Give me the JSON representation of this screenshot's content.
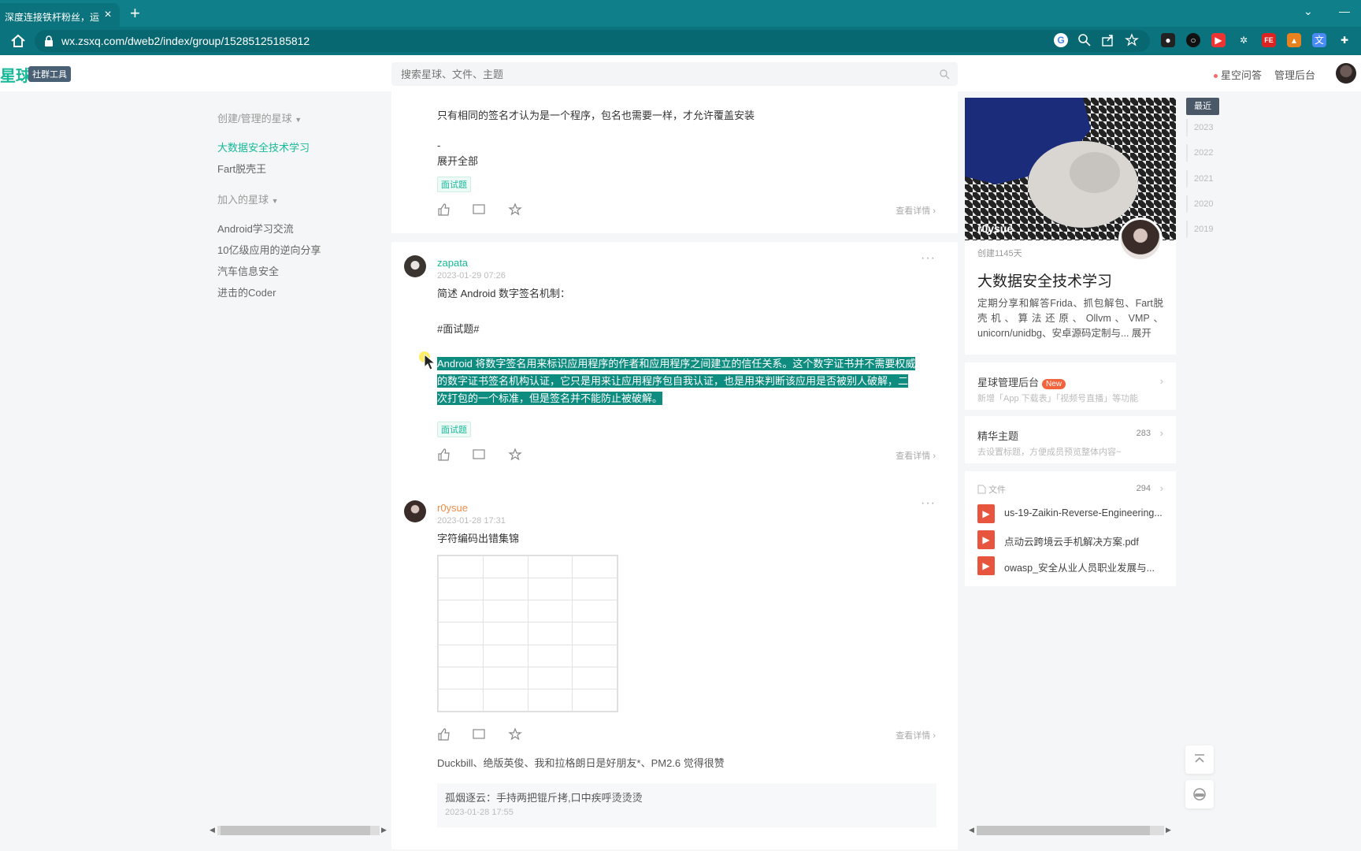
{
  "browser": {
    "tab_title": "深度连接铁杆粉丝，运",
    "tab_close": "×",
    "new_tab": "+",
    "url": "wx.zsxq.com/dweb2/index/group/15285125185812",
    "tab_list_glyph": "⌄",
    "window_min_glyph": "—"
  },
  "header": {
    "logo": "星球",
    "badge": "社群工具",
    "search_placeholder": "搜索星球、文件、主题",
    "qa_link": "星空问答",
    "admin_link": "管理后台"
  },
  "leftnav": {
    "created_group": "创建/管理的星球",
    "created_items": [
      "大数据安全技术学习",
      "Fart脱壳王"
    ],
    "joined_group": "加入的星球",
    "joined_items": [
      "Android学习交流",
      "10亿级应用的逆向分享",
      "汽车信息安全",
      "进击的Coder"
    ]
  },
  "feed": {
    "post1": {
      "text": "只有相同的签名才认为是一个程序，包名也需要一样，才允许覆盖安装",
      "dash": "-",
      "expand": "展开全部",
      "tag": "面试题",
      "detail": "查看详情"
    },
    "post2": {
      "author": "zapata",
      "time": "2023-01-29 07:26",
      "line1": "简述 Android 数字签名机制：",
      "hashtag": "#面试题#",
      "highlight_1": "Android 将数字签名用来标识应用程序的作者和应用程序之间建立的信任关系。这个数字证书并不需要权威",
      "highlight_2": "的数字证书签名机构认证，它只是用来让应用程序包自我认证，也是用来判断该应用是否被别人破解，二",
      "highlight_3": "次打包的一个标准，但是签名并不能防止被破解。",
      "tag": "面试题",
      "detail": "查看详情",
      "more": "···"
    },
    "post3": {
      "author": "r0ysue",
      "time": "2023-01-28 17:31",
      "title": "字符编码出错集锦",
      "detail": "查看详情",
      "more": "···",
      "likes": "Duckbill、绝版英俊、我和拉格朗日是好朋友*、PM2.6 觉得很赞",
      "comment": "孤烟逐云：手持两把锟斤拷,口中疾呼烫烫烫",
      "comment_time": "2023-01-28 17:55"
    }
  },
  "right": {
    "owner": "r0ysue",
    "days": "创建1145天",
    "group_title": "大数据安全技术学习",
    "group_desc": "定期分享和解答Frida、抓包解包、Fart脱壳机、算法还原、Ollvm、VMP、unicorn/unidbg、安卓源码定制与...",
    "expand": "展开",
    "admin_title": "星球管理后台",
    "admin_badge": "New",
    "admin_sub": "新增「App 下载表」「视频号直播」等功能",
    "essence_title": "精华主题",
    "essence_count": "283",
    "essence_sub": "去设置标题，方便成员预览整体内容~",
    "files_title": "文件",
    "files_count": "294",
    "files": [
      "us-19-Zaikin-Reverse-Engineering...",
      "点动云跨境云手机解决方案.pdf",
      "owasp_安全从业人员职业发展与..."
    ],
    "arrow": "›"
  },
  "years": {
    "latest": "最近",
    "list": [
      "2023",
      "2022",
      "2021",
      "2020",
      "2019"
    ]
  },
  "colors": {
    "accent": "#16b998",
    "chrome": "#0f7f8a",
    "highlight": "#0e8c7f"
  }
}
